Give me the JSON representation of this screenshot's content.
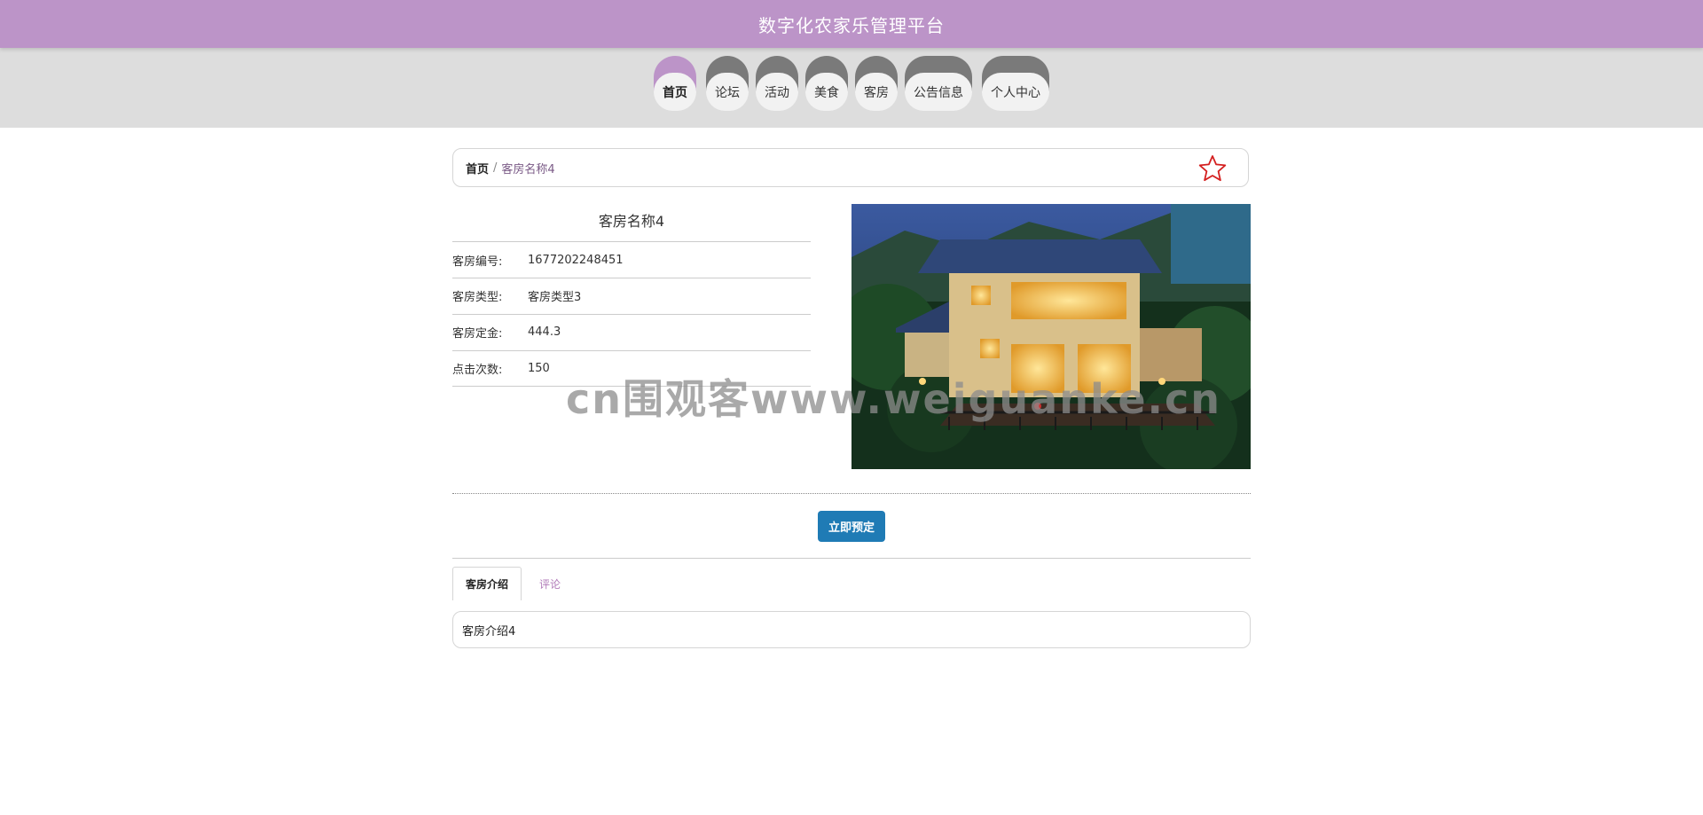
{
  "header": {
    "title": "数字化农家乐管理平台"
  },
  "nav": [
    {
      "label": "首页",
      "active": true
    },
    {
      "label": "论坛",
      "active": false
    },
    {
      "label": "活动",
      "active": false
    },
    {
      "label": "美食",
      "active": false
    },
    {
      "label": "客房",
      "active": false
    },
    {
      "label": "公告信息",
      "active": false
    },
    {
      "label": "个人中心",
      "active": false
    }
  ],
  "breadcrumb": {
    "home": "首页",
    "separator": "/",
    "current": "客房名称4"
  },
  "room": {
    "name": "客房名称4",
    "fields": [
      {
        "label": "客房编号:",
        "value": "1677202248451"
      },
      {
        "label": "客房类型:",
        "value": "客房类型3"
      },
      {
        "label": "客房定金:",
        "value": "444.3"
      },
      {
        "label": "点击次数:",
        "value": "150"
      }
    ]
  },
  "watermark": "cn围观客www.weiguanke.cn",
  "actions": {
    "book_label": "立即预定"
  },
  "tabs": [
    {
      "label": "客房介绍",
      "active": true
    },
    {
      "label": "评论",
      "active": false
    }
  ],
  "tab_content": "客房介绍4",
  "colors": {
    "brand": "#bc94c8",
    "nav_inactive": "#7a7a7a",
    "button": "#1f7bb5",
    "star": "#d42020"
  }
}
